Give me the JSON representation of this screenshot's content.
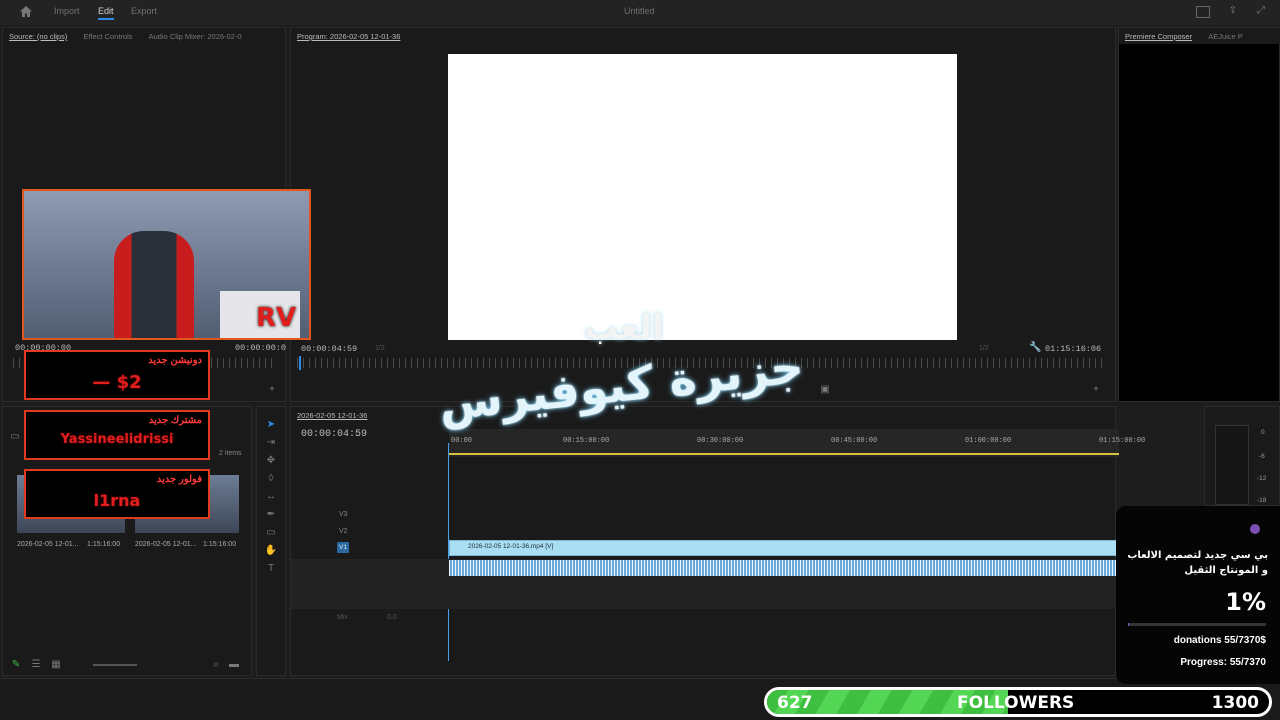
{
  "app": {
    "top_nav": {
      "import": "Import",
      "edit": "Edit",
      "export": "Export"
    },
    "document_title": "Untitled"
  },
  "source_panel": {
    "tabs": [
      "Source: (no clips)",
      "Effect Controls",
      "Audio Clip Mixer: 2026-02-0"
    ],
    "timecode_left": "00;00;00;00",
    "timecode_right": "00:00:00:0"
  },
  "program_panel": {
    "title": "Program: 2026-02-05 12-01-36",
    "timecode": "00:00:04:59",
    "duration": "01:15:16:06",
    "fit_label": "1/2",
    "fit_label_right": "1/2"
  },
  "right_panel": {
    "tabs": [
      "Premiere Composer",
      "AEJuice P"
    ]
  },
  "project_panel": {
    "items_count": "2 items",
    "clips": [
      {
        "name": "2026-02-05 12-01...",
        "duration": "1:15:16:00"
      },
      {
        "name": "2026-02-05 12-01...",
        "duration": "1:15:16:00"
      }
    ]
  },
  "timeline": {
    "sequence_tab": "2026-02-05 12-01-36",
    "timecode": "00:00:04:59",
    "ruler_labels": [
      "00:00",
      "00:15:00:00",
      "00:30:00:00",
      "00:45:00:00",
      "01:00:00:00",
      "01:15:00:00"
    ],
    "tracks": [
      "V3",
      "V2",
      "V1",
      "A1",
      "A2",
      "A3"
    ],
    "master_label": "Mix",
    "master_value": "0.0",
    "video_clip": "2026-02-05 12-01-36.mp4 [V]"
  },
  "audio_meter": {
    "labels": [
      "0",
      "-6",
      "-12",
      "-18"
    ]
  },
  "overlays": {
    "watermark_small": "العب",
    "watermark_big": "جزيرة كيوفيرس",
    "alerts": [
      {
        "label": "دونيشن جديد",
        "value": "—   $2"
      },
      {
        "label": "مشترك جديد",
        "value": "Yassineelidrissi"
      },
      {
        "label": "فولور جديد",
        "value": "l1rna"
      }
    ],
    "cam_logo": "RV",
    "donation": {
      "title": "بي سي جديد لتصميم الالعاب و المونتاج الثقيل",
      "percent": "1%",
      "percent_value": 0.0075,
      "donations": "donations 55/7370$",
      "progress": "Progress: 55/7370"
    },
    "followers": {
      "current": "627",
      "label": "FOLLOWERS",
      "goal": "1300",
      "fill_fraction": 0.48
    }
  },
  "colors": {
    "accent": "#2d8ceb",
    "alert_red": "#e03a1f",
    "follow_green": "#3fbf3f",
    "clip_blue": "#a9def2"
  }
}
